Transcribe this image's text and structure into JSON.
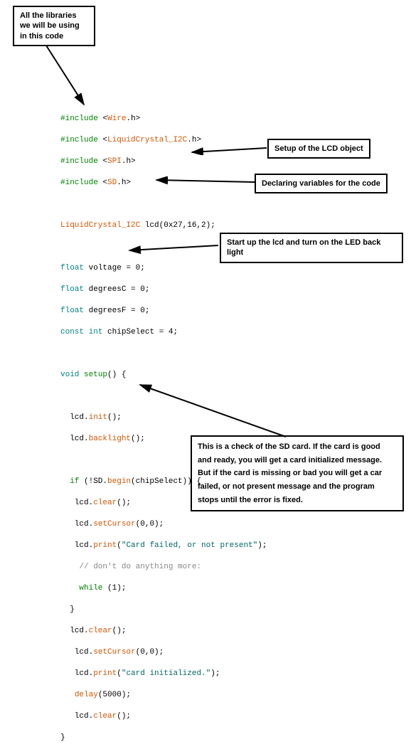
{
  "callouts": {
    "libraries": "All the libraries\nwe will be using\nin this code",
    "lcd_setup": "Setup of the LCD object",
    "variables": "Declaring variables for the code",
    "lcd_start": "Start up the lcd and turn on the LED back\nlight",
    "sd_check": "This is a check of the SD card. If the card is good\nand ready, you will get a card initialized message.\nBut if the card is missing or bad you will get a car\nfailed, or not present message and the program\nstops until the error is fixed."
  },
  "code": {
    "l01_a": "#include",
    "l01_b": "<",
    "l01_c": "Wire",
    "l01_d": ".h>",
    "l02_a": "#include",
    "l02_b": "<",
    "l02_c": "LiquidCrystal_I2C",
    "l02_d": ".h>",
    "l03_a": "#include",
    "l03_b": "<",
    "l03_c": "SPI",
    "l03_d": ".h>",
    "l04_a": "#include",
    "l04_b": "<",
    "l04_c": "SD",
    "l04_d": ".h>",
    "l06_a": "LiquidCrystal_I2C",
    "l06_b": " lcd(0x27,16,2);",
    "l08_a": "float",
    "l08_b": " voltage = 0;",
    "l09_a": "float",
    "l09_b": " degreesC = 0;",
    "l10_a": "float",
    "l10_b": " degreesF = 0;",
    "l11_a": "const",
    "l11_b": " ",
    "l11_c": "int",
    "l11_d": " chipSelect = 4;",
    "l13_a": "void",
    "l13_b": " ",
    "l13_c": "setup",
    "l13_d": "() {",
    "l15_a": "  lcd.",
    "l15_b": "init",
    "l15_c": "();",
    "l16_a": "  lcd.",
    "l16_b": "backlight",
    "l16_c": "();",
    "l18_a": "  ",
    "l18_b": "if",
    "l18_c": " (!SD.",
    "l18_d": "begin",
    "l18_e": "(chipSelect)) {",
    "l19_a": "   lcd.",
    "l19_b": "clear",
    "l19_c": "();",
    "l20_a": "   lcd.",
    "l20_b": "setCursor",
    "l20_c": "(0,0);",
    "l21_a": "   lcd.",
    "l21_b": "print",
    "l21_c": "(",
    "l21_d": "\"Card failed, or not present\"",
    "l21_e": ");",
    "l22_a": "    // don't do anything more:",
    "l23_a": "    ",
    "l23_b": "while",
    "l23_c": " (1);",
    "l24_a": "  }",
    "l25_a": "  lcd.",
    "l25_b": "clear",
    "l25_c": "();",
    "l26_a": "   lcd.",
    "l26_b": "setCursor",
    "l26_c": "(0,0);",
    "l27_a": "   lcd.",
    "l27_b": "print",
    "l27_c": "(",
    "l27_d": "\"card initialized.\"",
    "l27_e": ");",
    "l28_a": "   ",
    "l28_b": "delay",
    "l28_c": "(5000);",
    "l29_a": "   lcd.",
    "l29_b": "clear",
    "l29_c": "();",
    "l30_a": "}"
  }
}
